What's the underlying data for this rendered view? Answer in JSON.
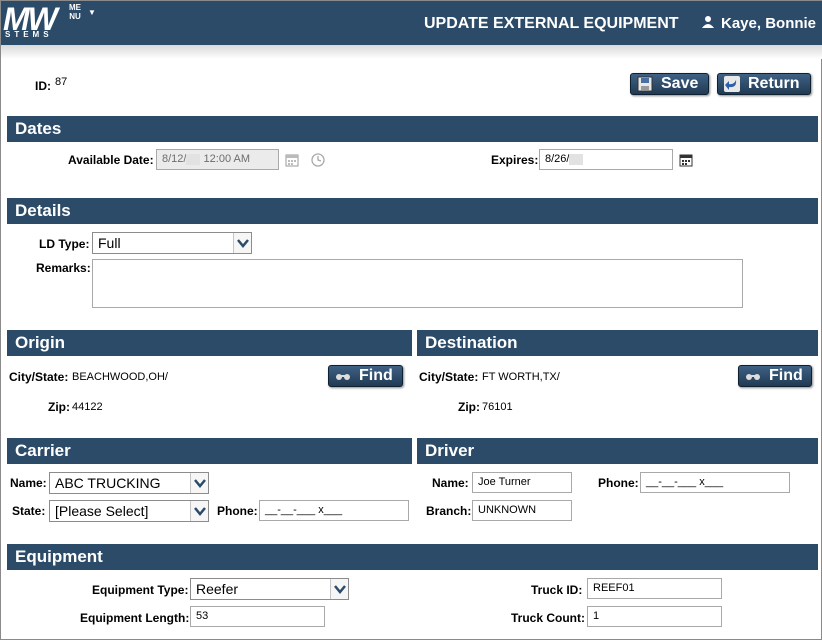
{
  "header": {
    "logo_text": "MW",
    "logo_sub": "STEMS",
    "menu_label": "MENU",
    "title": "UPDATE EXTERNAL EQUIPMENT",
    "user_name": "Kaye, Bonnie"
  },
  "record": {
    "id_label": "ID:",
    "id_value": "87"
  },
  "actions": {
    "save_label": "Save",
    "return_label": "Return"
  },
  "dates": {
    "section_title": "Dates",
    "available_label": "Available Date:",
    "available_date": "8/12/",
    "available_time": "12:00 AM",
    "expires_label": "Expires:",
    "expires_date": "8/26/"
  },
  "details": {
    "section_title": "Details",
    "ld_type_label": "LD Type:",
    "ld_type_value": "Full",
    "remarks_label": "Remarks:",
    "remarks_value": ""
  },
  "origin": {
    "section_title": "Origin",
    "city_label": "City/State:",
    "city_value": "BEACHWOOD,OH/",
    "zip_label": "Zip:",
    "zip_value": "44122",
    "find_label": "Find"
  },
  "destination": {
    "section_title": "Destination",
    "city_label": "City/State:",
    "city_value": "FT WORTH,TX/",
    "zip_label": "Zip:",
    "zip_value": "76101",
    "find_label": "Find"
  },
  "carrier": {
    "section_title": "Carrier",
    "name_label": "Name:",
    "name_value": "ABC TRUCKING",
    "state_label": "State:",
    "state_value": "[Please Select]",
    "phone_label": "Phone:",
    "phone_placeholder": "__-__-___ x___"
  },
  "driver": {
    "section_title": "Driver",
    "name_label": "Name:",
    "name_value": "Joe Turner",
    "phone_label": "Phone:",
    "phone_placeholder": "__-__-___ x___",
    "branch_label": "Branch:",
    "branch_value": "UNKNOWN"
  },
  "equipment": {
    "section_title": "Equipment",
    "type_label": "Equipment Type:",
    "type_value": "Reefer",
    "length_label": "Equipment Length:",
    "length_value": "53",
    "truck_id_label": "Truck ID:",
    "truck_id_value": "REEF01",
    "truck_count_label": "Truck Count:",
    "truck_count_value": "1"
  },
  "colors": {
    "header_bg": "#2c4b68",
    "button_bg": "#2b4661"
  }
}
